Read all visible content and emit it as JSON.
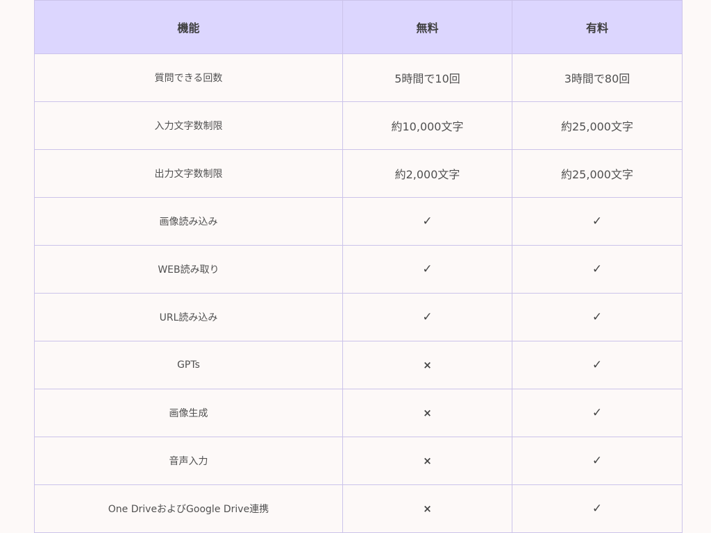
{
  "table": {
    "headers": [
      "機能",
      "無料",
      "有料"
    ],
    "rows": [
      {
        "feature": "質問できる回数",
        "free": "5時間で10回",
        "paid": "3時間で80回"
      },
      {
        "feature": "入力文字数制限",
        "free": "約10,000文字",
        "paid": "約25,000文字"
      },
      {
        "feature": "出力文字数制限",
        "free": "約2,000文字",
        "paid": "約25,000文字"
      },
      {
        "feature": "画像読み込み",
        "free": "✓",
        "paid": "✓"
      },
      {
        "feature": "WEB読み取り",
        "free": "✓",
        "paid": "✓"
      },
      {
        "feature": "URL読み込み",
        "free": "✓",
        "paid": "✓"
      },
      {
        "feature": "GPTs",
        "free": "×",
        "paid": "✓"
      },
      {
        "feature": "画像生成",
        "free": "×",
        "paid": "✓"
      },
      {
        "feature": "音声入力",
        "free": "×",
        "paid": "✓"
      },
      {
        "feature": "One DriveおよびGoogle Drive連携",
        "free": "×",
        "paid": "✓"
      }
    ]
  },
  "colors": {
    "header_bg": "#dcd6fe",
    "border": "#cbc3ea",
    "page_bg": "#fdf9f8",
    "text": "#4a4a4a"
  }
}
